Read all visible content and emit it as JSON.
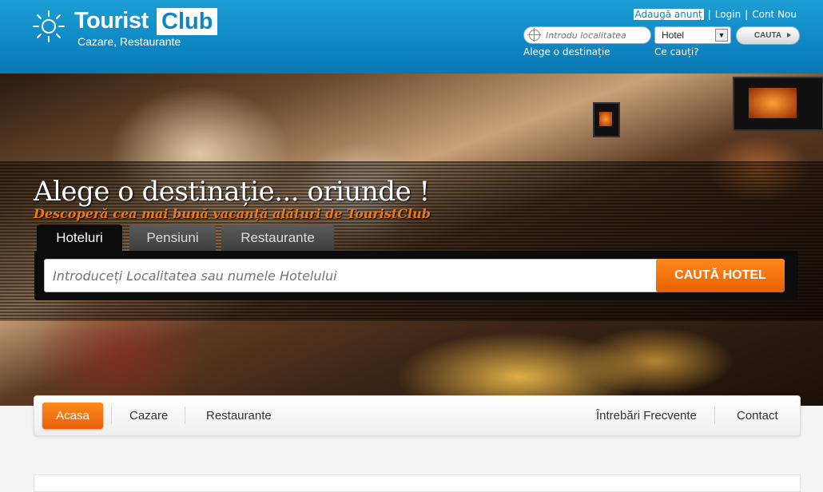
{
  "header": {
    "logo": {
      "word1": "Tourist",
      "word2": "Club",
      "tagline": "Cazare, Restaurante"
    },
    "links": {
      "add": "Adaugă anunț",
      "login": "Login",
      "account": "Cont Nou",
      "separator": "|"
    },
    "quick_search": {
      "location_placeholder": "Introdu localitatea",
      "type_value": "Hotel",
      "button_label": "CAUTA",
      "hint_destination": "Alege o destinație",
      "hint_type": "Ce cauți?"
    }
  },
  "hero": {
    "title": "Alege o destinație... oriunde !",
    "subtitle": "Descoperă cea mai bună vacanță alături de TouristClub",
    "tabs": [
      "Hoteluri",
      "Pensiuni",
      "Restaurante"
    ],
    "active_tab": "Hoteluri",
    "search_placeholder": "Introduceți Localitatea sau numele Hotelului",
    "search_button": "CAUTĂ HOTEL"
  },
  "nav": {
    "items": [
      "Acasa",
      "Cazare",
      "Restaurante",
      "Întrebări Frecvente",
      "Contact"
    ],
    "active": "Acasa"
  },
  "colors": {
    "brand_blue": "#0e86c2",
    "accent_orange": "#f07a12"
  }
}
